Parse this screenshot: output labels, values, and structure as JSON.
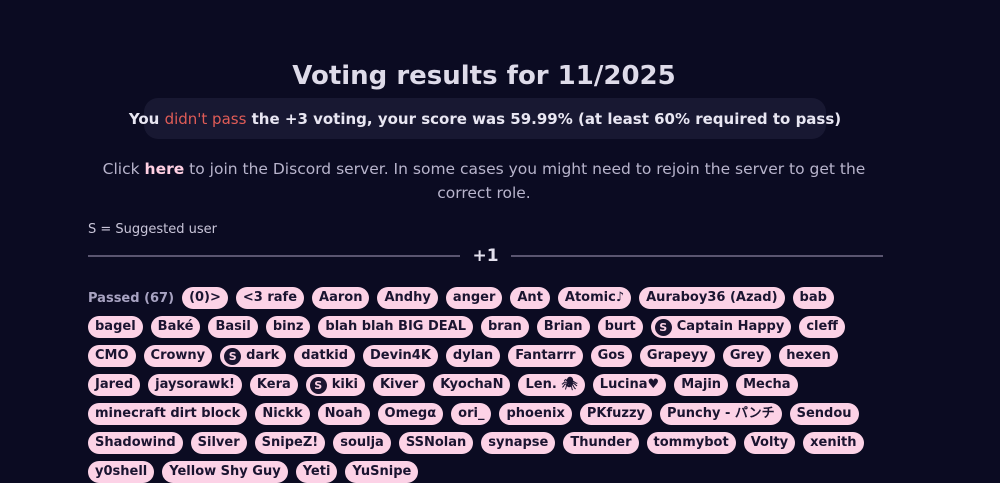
{
  "page_title": "Voting results for 11/2025",
  "result": {
    "prefix": "You ",
    "status": "didn't pass",
    "suffix": " the +3 voting, your score was 59.99% (at least 60% required to pass)"
  },
  "discord": {
    "prefix": "Click ",
    "link": "here",
    "suffix": " to join the Discord server. In some cases you might need to rejoin the server to get the correct role."
  },
  "legend": "S = Suggested user",
  "section_label": "+1",
  "passed_label": "Passed (67)",
  "suggested_icon": "S",
  "users": [
    {
      "name": "(0)>",
      "suggested": false
    },
    {
      "name": "<3 rafe",
      "suggested": false
    },
    {
      "name": "Aaron",
      "suggested": false
    },
    {
      "name": "Andhy",
      "suggested": false
    },
    {
      "name": "anger",
      "suggested": false
    },
    {
      "name": "Ant",
      "suggested": false
    },
    {
      "name": "Atomic♪",
      "suggested": false
    },
    {
      "name": "Auraboy36 (Azad)",
      "suggested": false
    },
    {
      "name": "bab",
      "suggested": false
    },
    {
      "name": "bagel",
      "suggested": false
    },
    {
      "name": "Baké",
      "suggested": false
    },
    {
      "name": "Basil",
      "suggested": false
    },
    {
      "name": "binz",
      "suggested": false
    },
    {
      "name": "blah blah BIG DEAL",
      "suggested": false
    },
    {
      "name": "bran",
      "suggested": false
    },
    {
      "name": "Brian",
      "suggested": false
    },
    {
      "name": "burt",
      "suggested": false
    },
    {
      "name": "Captain Happy",
      "suggested": true
    },
    {
      "name": "cleff",
      "suggested": false
    },
    {
      "name": "CMO",
      "suggested": false
    },
    {
      "name": "Crowny",
      "suggested": false
    },
    {
      "name": "dark",
      "suggested": true
    },
    {
      "name": "datkid",
      "suggested": false
    },
    {
      "name": "Devin4K",
      "suggested": false
    },
    {
      "name": "dylan",
      "suggested": false
    },
    {
      "name": "Fantarrr",
      "suggested": false
    },
    {
      "name": "Gos",
      "suggested": false
    },
    {
      "name": "Grapeyy",
      "suggested": false
    },
    {
      "name": "Grey",
      "suggested": false
    },
    {
      "name": "hexen",
      "suggested": false
    },
    {
      "name": "Jared",
      "suggested": false
    },
    {
      "name": "jaysorawk!",
      "suggested": false
    },
    {
      "name": "Kera",
      "suggested": false
    },
    {
      "name": "kiki",
      "suggested": true
    },
    {
      "name": "Kiver",
      "suggested": false
    },
    {
      "name": "KyochaN",
      "suggested": false
    },
    {
      "name": "Len. 🕷",
      "suggested": false
    },
    {
      "name": "Lucina♥",
      "suggested": false
    },
    {
      "name": "Majin",
      "suggested": false
    },
    {
      "name": "Mecha",
      "suggested": false
    },
    {
      "name": "minecraft dirt block",
      "suggested": false
    },
    {
      "name": "Nickk",
      "suggested": false
    },
    {
      "name": "Noah",
      "suggested": false
    },
    {
      "name": "Omegα",
      "suggested": false
    },
    {
      "name": "ori_",
      "suggested": false
    },
    {
      "name": "phoenix",
      "suggested": false
    },
    {
      "name": "PKfuzzy",
      "suggested": false
    },
    {
      "name": "Punchy - パンチ",
      "suggested": false
    },
    {
      "name": "Sendou",
      "suggested": false
    },
    {
      "name": "Shadowind",
      "suggested": false
    },
    {
      "name": "Silver",
      "suggested": false
    },
    {
      "name": "SnipeZ!",
      "suggested": false
    },
    {
      "name": "soulja",
      "suggested": false
    },
    {
      "name": "SSNolan",
      "suggested": false
    },
    {
      "name": "synapse",
      "suggested": false
    },
    {
      "name": "Thunder",
      "suggested": false
    },
    {
      "name": "tommybot",
      "suggested": false
    },
    {
      "name": "Volty",
      "suggested": false
    },
    {
      "name": "xenith",
      "suggested": false
    },
    {
      "name": "y0shell",
      "suggested": false
    },
    {
      "name": "Yellow Shy Guy",
      "suggested": false
    },
    {
      "name": "Yeti",
      "suggested": false
    },
    {
      "name": "YuSnipe",
      "suggested": false
    }
  ],
  "colors": {
    "background": "#0b0b22",
    "chip_bg": "#fcd2e6",
    "fail": "#e05c57",
    "box_bg": "#181832"
  }
}
